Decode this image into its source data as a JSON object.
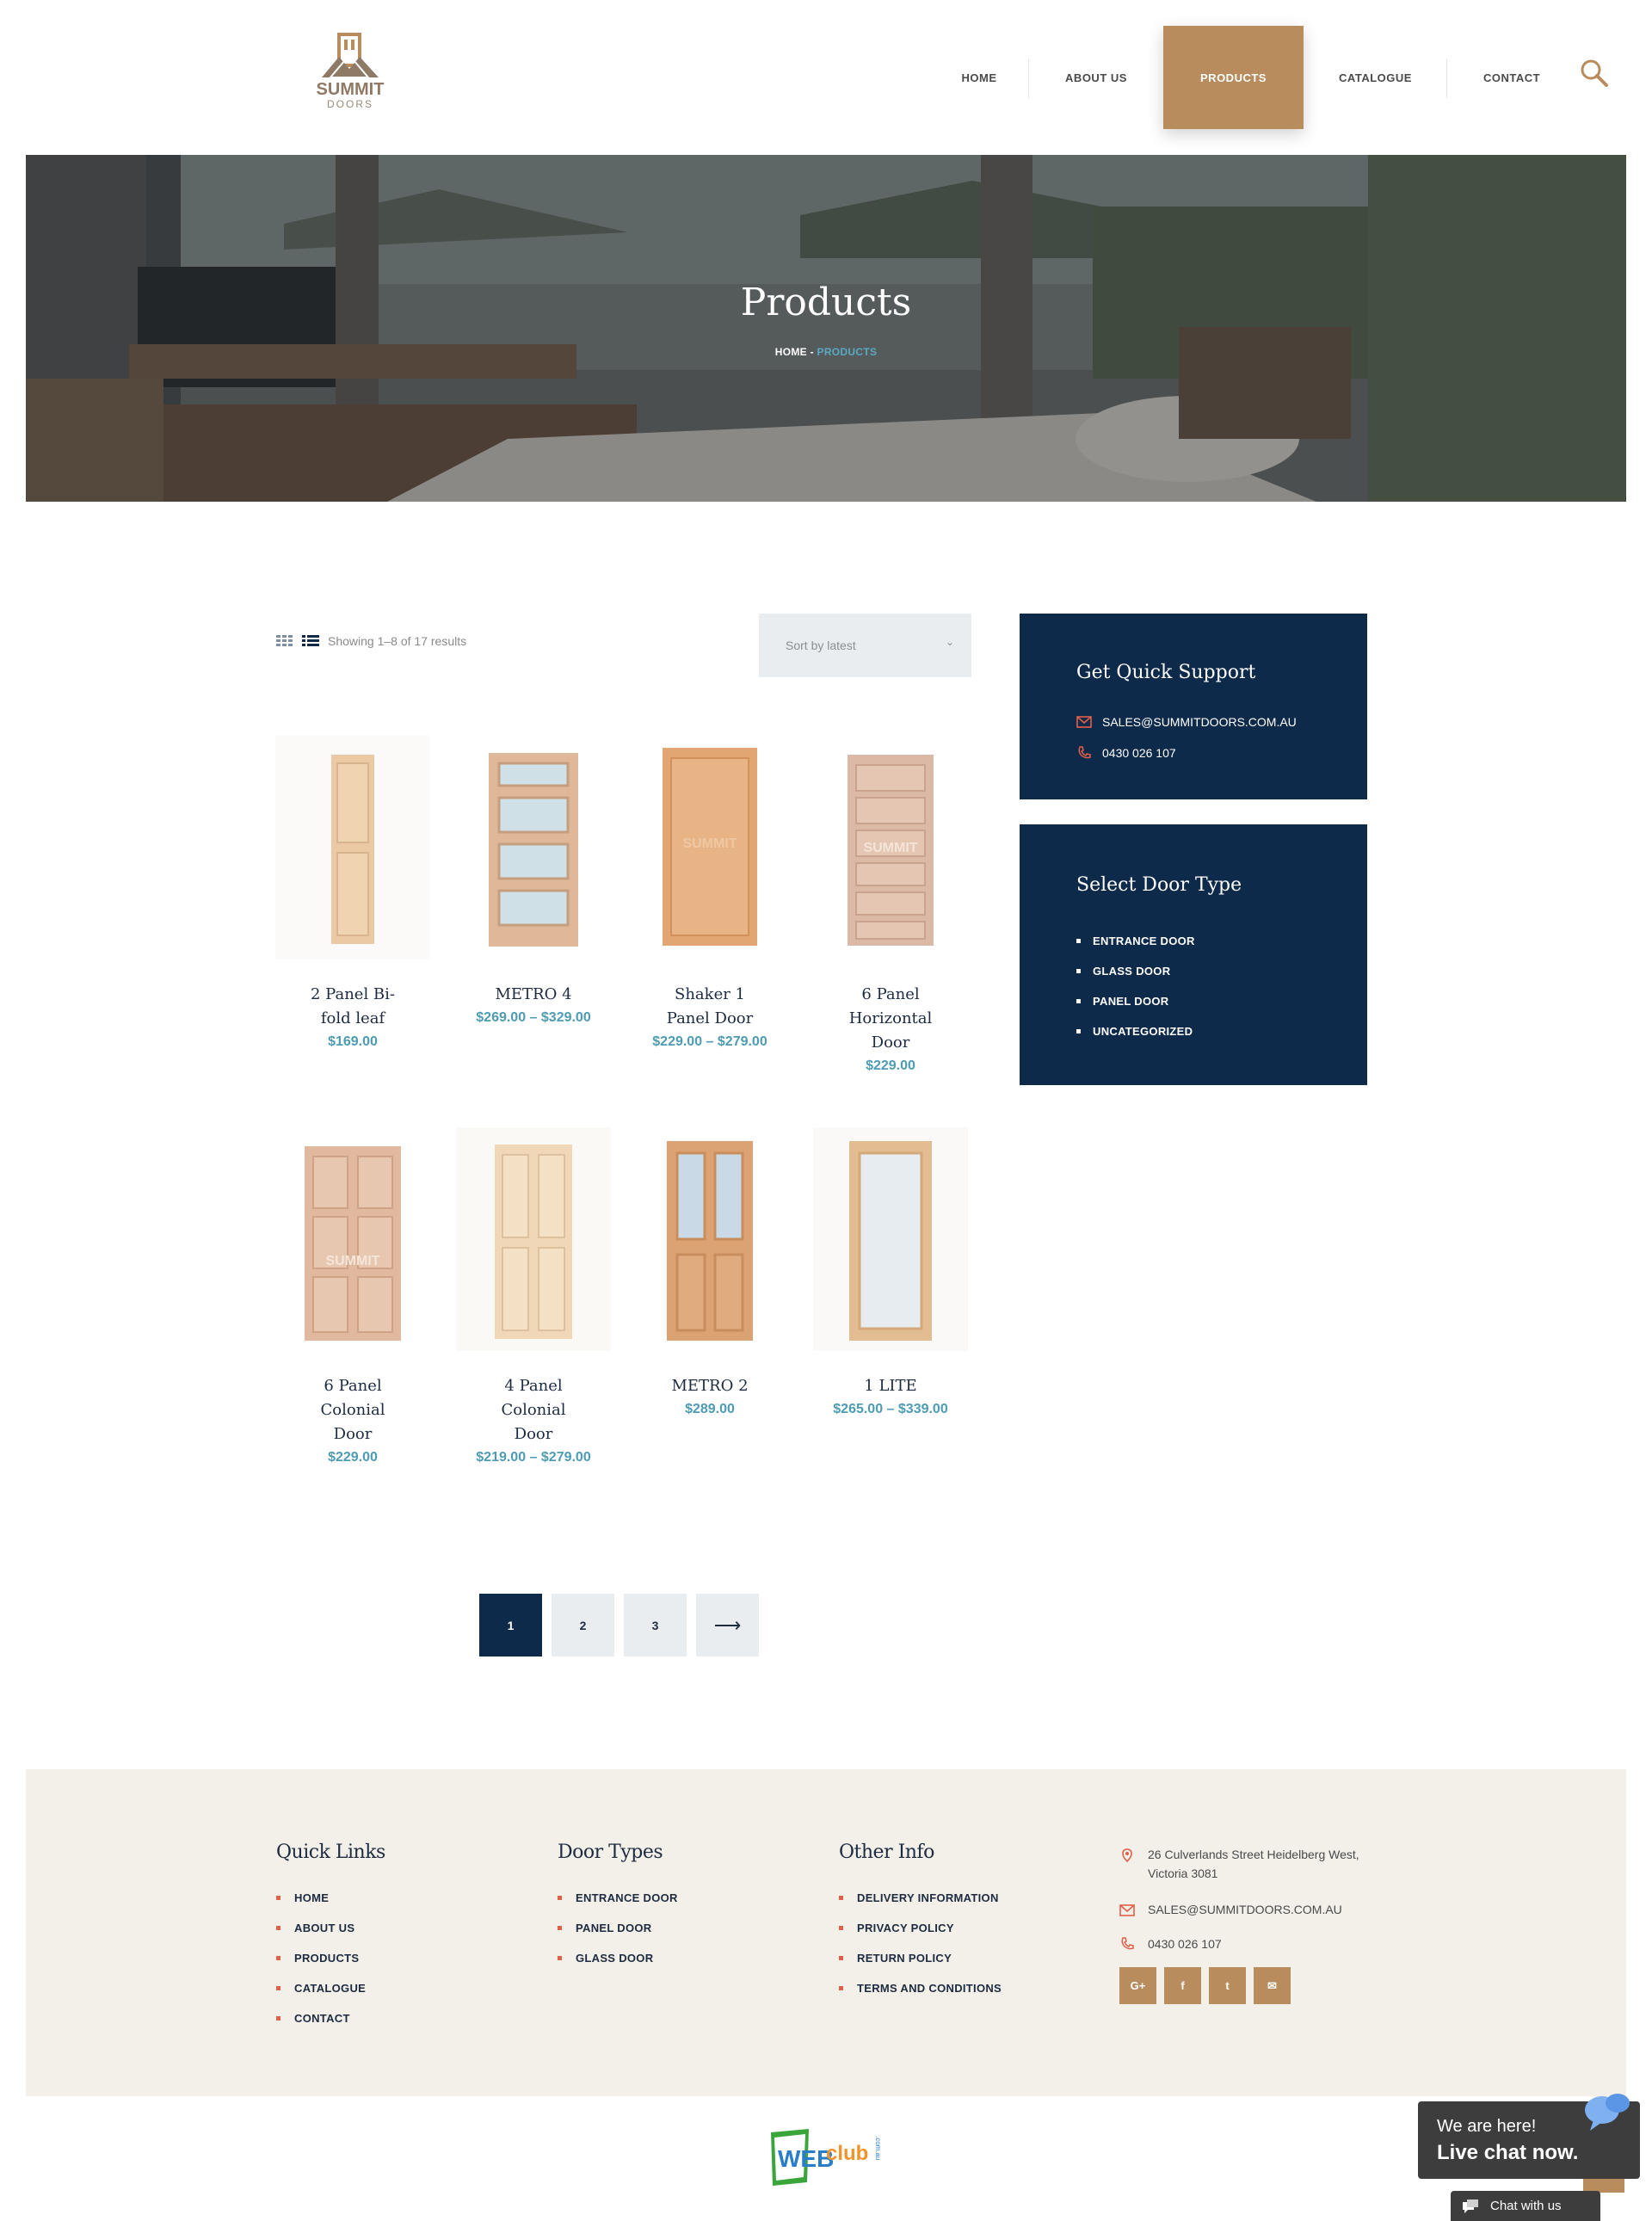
{
  "brand": {
    "name": "SUMMIT",
    "sub": "DOORS",
    "accent_color": "#b88c5c",
    "navy_color": "#0e2a4b",
    "price_color": "#4d9cb4"
  },
  "nav": {
    "items": [
      {
        "label": "HOME",
        "active": false
      },
      {
        "label": "ABOUT US",
        "active": false
      },
      {
        "label": "PRODUCTS",
        "active": true
      },
      {
        "label": "CATALOGUE",
        "active": false
      },
      {
        "label": "CONTACT",
        "active": false
      }
    ],
    "search_icon": "search-icon"
  },
  "hero": {
    "title": "Products",
    "breadcrumb": {
      "home": "HOME",
      "separator": " - ",
      "current": "PRODUCTS"
    }
  },
  "toolbar": {
    "results": "Showing 1–8 of 17 results",
    "sort_label": "Sort by latest",
    "grid_icon": "grid-view-icon",
    "list_icon": "list-view-icon",
    "sort_icon": "chevron-down-icon"
  },
  "products": [
    {
      "name": "2 Panel Bi-fold leaf",
      "price": "$169.00"
    },
    {
      "name": "METRO 4",
      "price": "$269.00 – $329.00"
    },
    {
      "name": "Shaker 1 Panel Door",
      "price": "$229.00 – $279.00"
    },
    {
      "name": "6 Panel Horizontal Door",
      "price": "$229.00"
    },
    {
      "name": "6 Panel Colonial Door",
      "price": "$229.00"
    },
    {
      "name": "4 Panel Colonial Door",
      "price": "$219.00 – $279.00"
    },
    {
      "name": "METRO 2",
      "price": "$289.00"
    },
    {
      "name": "1 LITE",
      "price": "$265.00 – $339.00"
    }
  ],
  "pagination": {
    "pages": [
      "1",
      "2",
      "3"
    ],
    "current": "1",
    "next_label": "⟶"
  },
  "sidebar": {
    "support": {
      "title": "Get Quick Support",
      "email": "SALES@SUMMITDOORS.COM.AU",
      "phone": "0430 026 107"
    },
    "door_types": {
      "title": "Select Door Type",
      "items": [
        "ENTRANCE DOOR",
        "GLASS DOOR",
        "PANEL DOOR",
        "UNCATEGORIZED"
      ]
    }
  },
  "footer": {
    "quick_links": {
      "title": "Quick Links",
      "items": [
        "HOME",
        "ABOUT US",
        "PRODUCTS",
        "CATALOGUE",
        "CONTACT"
      ]
    },
    "door_types": {
      "title": "Door Types",
      "items": [
        "ENTRANCE DOOR",
        "PANEL DOOR",
        "GLASS DOOR"
      ]
    },
    "other_info": {
      "title": "Other Info",
      "items": [
        "DELIVERY INFORMATION",
        "PRIVACY POLICY",
        "RETURN POLICY",
        "TERMS AND CONDITIONS"
      ]
    },
    "contact": {
      "address_line1": "26 Culverlands Street Heidelberg West,",
      "address_line2": "Victoria 3081",
      "email": "SALES@SUMMITDOORS.COM.AU",
      "phone": "0430 026 107"
    },
    "social": [
      {
        "icon": "google-plus-icon",
        "glyph": "G+"
      },
      {
        "icon": "facebook-icon",
        "glyph": "f"
      },
      {
        "icon": "twitter-icon",
        "glyph": "t"
      },
      {
        "icon": "email-icon",
        "glyph": "✉"
      }
    ]
  },
  "credit": {
    "text_web": "WEB",
    "text_club": "club",
    "text_domain": ".com.au"
  },
  "chat": {
    "line1": "We are here!",
    "line2": "Live chat now.",
    "tab": "Chat with us"
  }
}
